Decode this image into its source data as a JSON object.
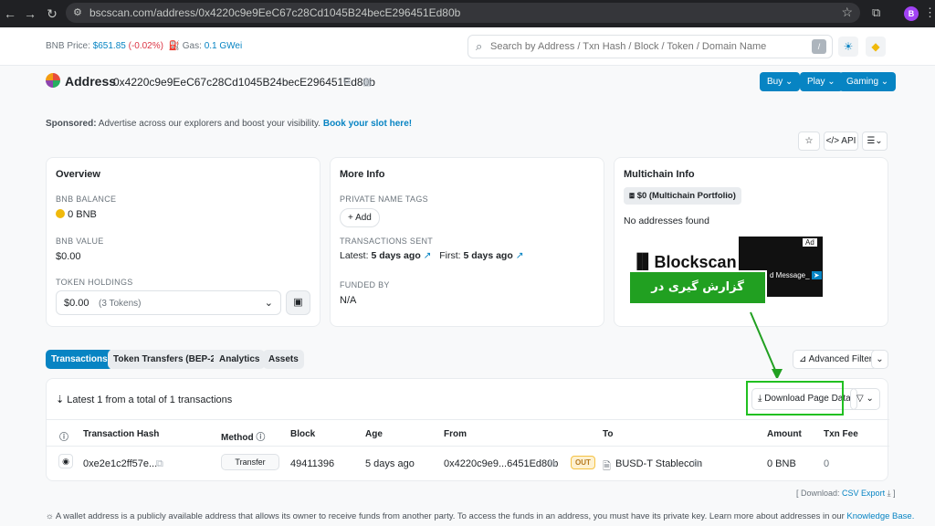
{
  "browser": {
    "url": "bscscan.com/address/0x4220c9e9EeC67c28Cd1045B24becE296451Ed80b",
    "profile_initial": "B"
  },
  "header": {
    "bnb_price_label": "BNB Price:",
    "bnb_price": "$651.85",
    "bnb_change": "(-0.02%)",
    "gas_label": "Gas:",
    "gas_value": "0.1 GWei",
    "search_placeholder": "Search by Address / Txn Hash / Block / Token / Domain Name",
    "slash_key": "/"
  },
  "address": {
    "title": "Address",
    "hash": "0x4220c9e9EeC67c28Cd1045B24becE296451Ed80b",
    "buttons": [
      "Buy",
      "Play",
      "Gaming"
    ]
  },
  "sponsored": {
    "label": "Sponsored:",
    "text": "Advertise across our explorers and boost your visibility.",
    "link": "Book your slot here!"
  },
  "actions": {
    "api": "API"
  },
  "overview": {
    "title": "Overview",
    "balance_label": "BNB BALANCE",
    "balance": "0 BNB",
    "value_label": "BNB VALUE",
    "value": "$0.00",
    "holdings_label": "TOKEN HOLDINGS",
    "holdings_value": "$0.00",
    "holdings_count": "(3 Tokens)"
  },
  "more_info": {
    "title": "More Info",
    "private_tags_label": "PRIVATE NAME TAGS",
    "add_button": "+ Add",
    "tx_sent_label": "TRANSACTIONS SENT",
    "latest_label": "Latest:",
    "latest_value": "5 days ago",
    "first_label": "First:",
    "first_value": "5 days ago",
    "funded_by_label": "FUNDED BY",
    "funded_by": "N/A"
  },
  "multichain": {
    "title": "Multichain Info",
    "portfolio": "$0 (Multichain Portfolio)",
    "no_addresses": "No addresses found",
    "ad_brand": "Blockscan",
    "ad_label": "Ad",
    "ad_message": "d Message_"
  },
  "annotation": "گزارش گیری در مرورگر",
  "tabs": [
    "Transactions",
    "Token Transfers (BEP-20)",
    "Analytics",
    "Assets"
  ],
  "advanced_filter": "Advanced Filter",
  "table": {
    "summary": "Latest 1 from a total of 1 transactions",
    "download_button": "Download Page Data",
    "headers": [
      "Transaction Hash",
      "Method",
      "Block",
      "Age",
      "From",
      "To",
      "Amount",
      "Txn Fee"
    ],
    "rows": [
      {
        "hash": "0xe2e1c2ff57e...",
        "method": "Transfer",
        "block": "49411396",
        "age": "5 days ago",
        "from": "0x4220c9e9...6451Ed80b",
        "direction": "OUT",
        "to": "BUSD-T Stablecoin",
        "amount": "0 BNB",
        "fee": "0"
      }
    ]
  },
  "download_csv": {
    "prefix": "[ Download:",
    "link": "CSV Export"
  },
  "footer_note": {
    "text": "A wallet address is a publicly available address that allows its owner to receive funds from another party. To access the funds in an address, you must have its private key. Learn more about addresses in our",
    "link": "Knowledge Base."
  },
  "colors": {
    "accent": "#0784c3",
    "annotation_green": "#21a021",
    "out_badge": "#f5c243"
  }
}
